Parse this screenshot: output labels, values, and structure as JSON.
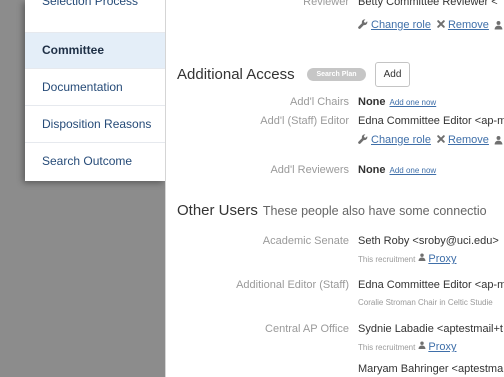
{
  "colors": {
    "backdrop": "#8c8c8c",
    "sidebar_text": "#264b78",
    "active_bg": "#e4eef8",
    "link": "#3f6fa9",
    "label": "#9a9a9a",
    "text": "#333333",
    "badge_bg": "#c6c6c6",
    "icon": "#6f6f6f"
  },
  "icons": {
    "change_role": "wrench-icon",
    "remove": "close-icon",
    "person": "user-icon"
  },
  "sidebar": {
    "items": [
      {
        "label": "Selection Process",
        "active": false
      },
      {
        "label": "Committee",
        "active": true
      },
      {
        "label": "Documentation",
        "active": false
      },
      {
        "label": "Disposition Reasons",
        "active": false
      },
      {
        "label": "Search Outcome",
        "active": false
      }
    ]
  },
  "committee": {
    "reviewer": {
      "label": "Reviewer",
      "value": "Betty Committee Reviewer <",
      "change_role": "Change role",
      "remove": "Remove"
    }
  },
  "additional_access": {
    "title": "Additional Access",
    "badge": "Search Plan",
    "add_button": "Add",
    "chairs": {
      "label": "Add'l Chairs",
      "value": "None",
      "add_link": "Add one now"
    },
    "staff_editor": {
      "label": "Add'l (Staff) Editor",
      "value": "Edna Committee Editor <ap-m",
      "change_role": "Change role",
      "remove": "Remove"
    },
    "reviewers": {
      "label": "Add'l Reviewers",
      "value": "None",
      "add_link": "Add one now"
    }
  },
  "other_users": {
    "title": "Other Users",
    "subtitle": "These people also have some connectio",
    "rows": [
      {
        "label": "Academic Senate",
        "value": "Seth Roby <sroby@uci.edu>",
        "note": "This recruitment",
        "proxy": "Proxy"
      },
      {
        "label": "Additional Editor (Staff)",
        "value": "Edna Committee Editor <ap-m",
        "note": "Coralie Stroman Chair in Celtic Studie"
      },
      {
        "label": "Central AP Office",
        "value": "Sydnie Labadie <aptestmail+t",
        "note": "This recruitment",
        "proxy": "Proxy"
      },
      {
        "value": "Maryam Bahringer <aptestma"
      }
    ]
  }
}
